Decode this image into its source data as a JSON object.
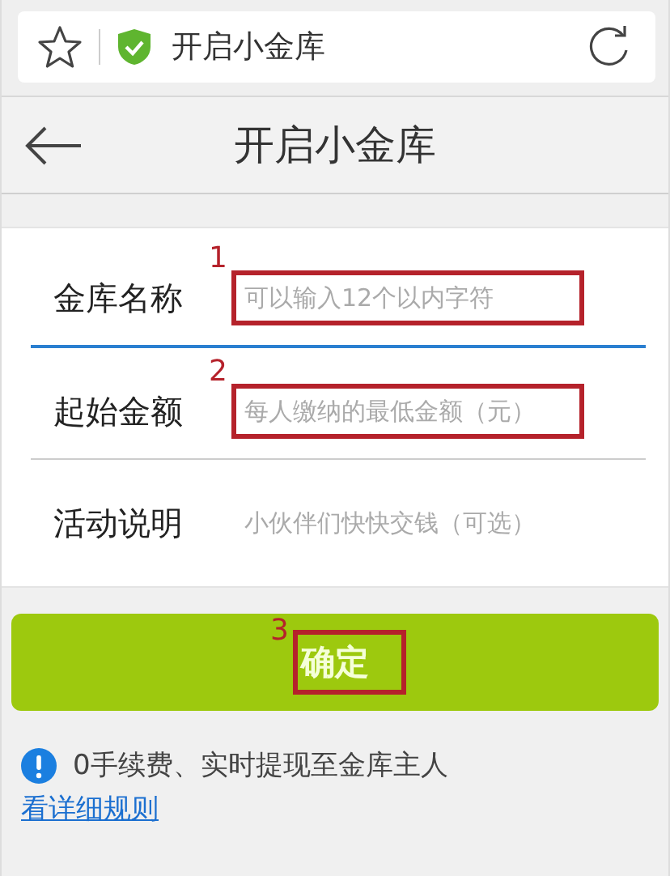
{
  "browser": {
    "page_title": "开启小金库"
  },
  "header": {
    "title": "开启小金库"
  },
  "fields": [
    {
      "label": "金库名称",
      "placeholder": "可以输入12个以内字符",
      "focused": true,
      "annotation": "1"
    },
    {
      "label": "起始金额",
      "placeholder": "每人缴纳的最低金额（元）",
      "focused": false,
      "annotation": "2"
    },
    {
      "label": "活动说明",
      "placeholder": "小伙伴们快快交钱（可选）",
      "focused": false
    }
  ],
  "submit": {
    "label": "确定",
    "annotation": "3"
  },
  "notice": {
    "text": "0手续费、实时提现至金库主人",
    "link": "看详细规则"
  }
}
